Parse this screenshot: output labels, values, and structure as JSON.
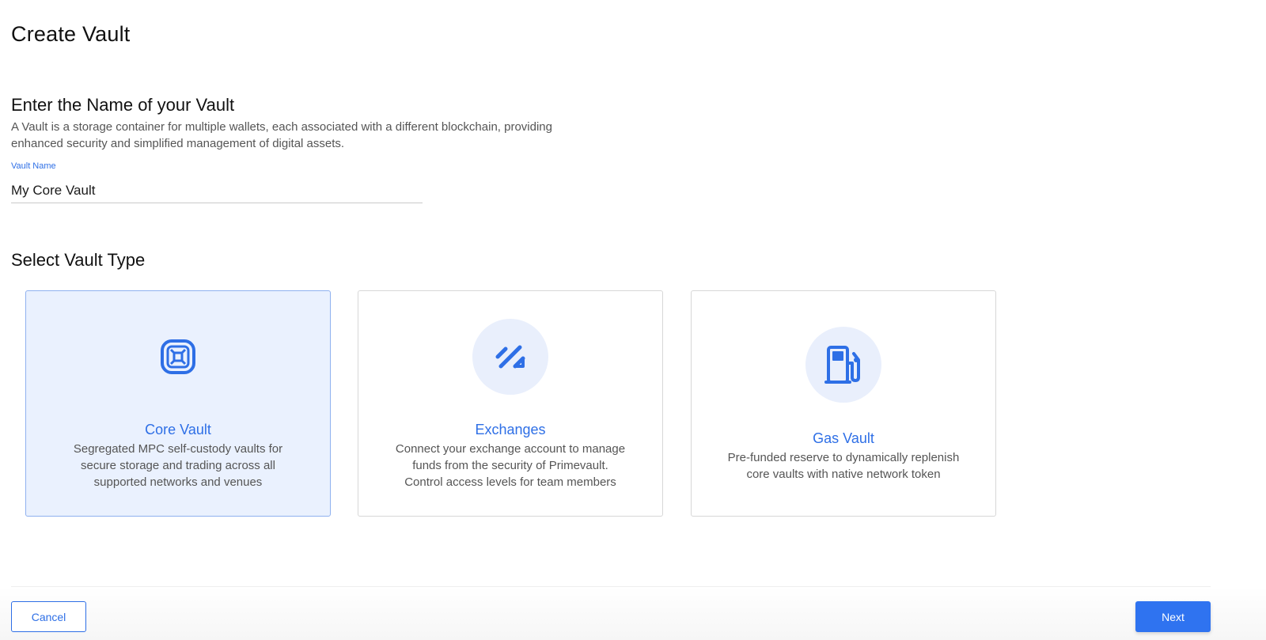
{
  "header": {
    "title": "Create Vault"
  },
  "vault_name_section": {
    "title": "Enter the Name of your Vault",
    "description_line1": "A Vault is a storage container for multiple wallets, each associated with a different blockchain, providing",
    "description_line2": "enhanced security and simplified management of digital assets.",
    "field_label": "Vault Name",
    "field_value": "My Core Vault"
  },
  "vault_type_section": {
    "title": "Select Vault Type",
    "selected": "Core Vault",
    "cards": [
      {
        "title": "Core Vault",
        "icon": "vault-icon",
        "desc_line1": "Segregated MPC self-custody vaults for",
        "desc_line2": "secure storage and trading across all",
        "desc_line3": "supported networks and venues"
      },
      {
        "title": "Exchanges",
        "icon": "exchange-icon",
        "desc_line1": "Connect your exchange account to manage",
        "desc_line2": "funds from the security of Primevault.",
        "desc_line3": "Control access levels for team members"
      },
      {
        "title": "Gas Vault",
        "icon": "gas-pump-icon",
        "desc_line1": "Pre-funded reserve to dynamically replenish",
        "desc_line2": "core vaults with native network token"
      }
    ]
  },
  "footer": {
    "cancel_label": "Cancel",
    "next_label": "Next"
  },
  "colors": {
    "accent": "#2e6fe6",
    "selected_card_bg": "#eaf1fe",
    "icon_circle_bg": "#e9effc"
  }
}
